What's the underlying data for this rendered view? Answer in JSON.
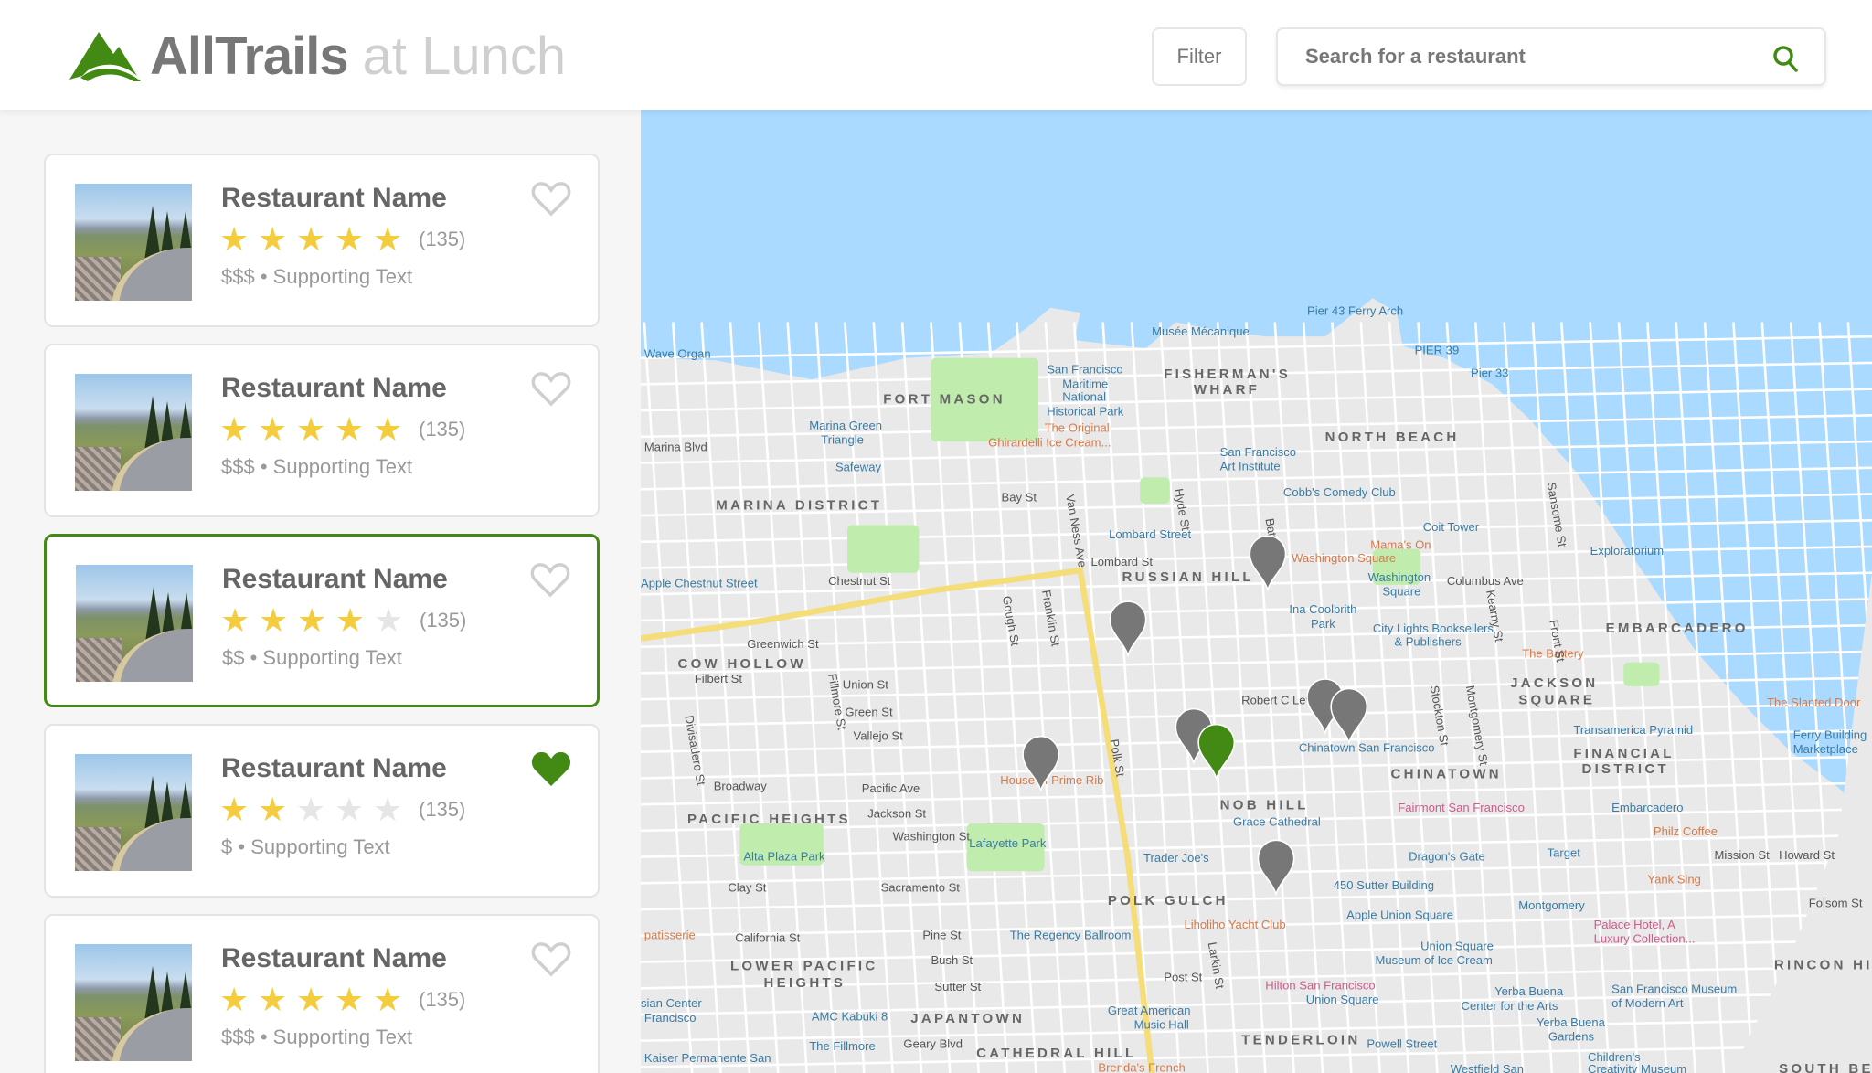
{
  "header": {
    "brand": "AllTrails",
    "brand_suffix": "at Lunch",
    "filter_label": "Filter",
    "search_placeholder": "Search for a restaurant",
    "accent": "#428a13"
  },
  "restaurants": [
    {
      "name": "Restaurant Name",
      "rating": 5,
      "reviews": "(135)",
      "price": "$$$",
      "supporting": "Supporting Text",
      "favorite": false,
      "selected": false
    },
    {
      "name": "Restaurant Name",
      "rating": 5,
      "reviews": "(135)",
      "price": "$$$",
      "supporting": "Supporting Text",
      "favorite": false,
      "selected": false
    },
    {
      "name": "Restaurant Name",
      "rating": 4,
      "reviews": "(135)",
      "price": "$$",
      "supporting": "Supporting Text",
      "favorite": false,
      "selected": true
    },
    {
      "name": "Restaurant Name",
      "rating": 2,
      "reviews": "(135)",
      "price": "$",
      "supporting": "Supporting Text",
      "favorite": true,
      "selected": false
    },
    {
      "name": "Restaurant Name",
      "rating": 5,
      "reviews": "(135)",
      "price": "$$$",
      "supporting": "Supporting Text",
      "favorite": false,
      "selected": false
    }
  ],
  "map": {
    "neighborhoods": [
      "FORT MASON",
      "FISHERMAN'S",
      "WHARF",
      "NORTH BEACH",
      "MARINA DISTRICT",
      "RUSSIAN HILL",
      "EMBARCADERO",
      "COW HOLLOW",
      "JACKSON",
      "SQUARE",
      "FINANCIAL",
      "DISTRICT",
      "CHINATOWN",
      "PACIFIC HEIGHTS",
      "NOB HILL",
      "POLK GULCH",
      "LOWER PACIFIC",
      "HEIGHTS",
      "JAPANTOWN",
      "TENDERLOIN",
      "CATHEDRAL HILL",
      "RINCON HILL",
      "SOUTH BE"
    ],
    "places": [
      "Pier 43 Ferry Arch",
      "Musée Mécanique",
      "PIER 39",
      "Pier 33",
      "Wave Organ",
      "San Francisco",
      "Maritime",
      "National",
      "Historical Park",
      "The Original",
      "Ghirardelli Ice Cream...",
      "Marina Green",
      "Triangle",
      "Safeway",
      "San Francisco",
      "Art Institute",
      "Cobb's Comedy Club",
      "Coit Tower",
      "Lombard Street",
      "Mama's On",
      "Washington Square",
      "Washington",
      "Square",
      "Exploratorium",
      "Apple Chestnut Street",
      "Ina Coolbrith",
      "Park",
      "City Lights Booksellers",
      "& Publishers",
      "The Battery",
      "The Slanted Door",
      "Transamerica Pyramid",
      "Ferry Building",
      "Marketplace",
      "Chinatown San Francisco",
      "Fairmont San Francisco",
      "Embarcadero",
      "Grace Cathedral",
      "Philz Coffee",
      "House of Prime Rib",
      "Alta Plaza Park",
      "Lafayette Park",
      "Trader Joe's",
      "Dragon's Gate",
      "Target",
      "450 Sutter Building",
      "Yank Sing",
      "Apple Union Square",
      "Montgomery",
      "Palace Hotel, A",
      "Luxury Collection...",
      "Liholiho Yacht Club",
      "The Regency Ballroom",
      "Union Square",
      "Museum of Ice Cream",
      "patisserie",
      "Hilton San Francisco",
      "Union Square",
      "Yerba Buena",
      "Center for the Arts",
      "San Francisco Museum",
      "of Modern Art",
      "Yerba Buena",
      "Gardens",
      "AMC Kabuki 8",
      "Great American",
      "Music Hall",
      "The Fillmore",
      "Powell Street",
      "Kaiser Permanente San",
      "sian Center",
      "Francisco",
      "Brenda's French",
      "Children's",
      "Creativity Museum",
      "Westfield San"
    ],
    "streets": [
      "Marina Blvd",
      "Bay St",
      "Chestnut St",
      "Lombard St",
      "Greenwich St",
      "Filbert St",
      "Union St",
      "Green St",
      "Vallejo St",
      "Broadway",
      "Pacific Ave",
      "Jackson St",
      "Washington St",
      "Clay St",
      "Sacramento St",
      "California St",
      "Pine St",
      "Bush St",
      "Sutter St",
      "Post St",
      "Geary Blvd",
      "Van Ness Ave",
      "Franklin St",
      "Gough St",
      "Fillmore St",
      "Divisadero St",
      "Hyde St",
      "Polk St",
      "Larkin St",
      "Robert C Levy",
      "Columbus Ave",
      "Kearny St",
      "Stockton St",
      "Montgomery St",
      "Sansome St",
      "Battery St",
      "Front St",
      "Mission St",
      "Howard St",
      "Folsom St"
    ],
    "markers": [
      {
        "state": "default"
      },
      {
        "state": "default"
      },
      {
        "state": "default"
      },
      {
        "state": "default"
      },
      {
        "state": "default"
      },
      {
        "state": "default"
      },
      {
        "state": "default"
      },
      {
        "state": "selected"
      }
    ],
    "water_color": "#aadaff",
    "land_color": "#e9e9e9",
    "park_color": "#c0ecae",
    "marker_color": "#777777"
  }
}
